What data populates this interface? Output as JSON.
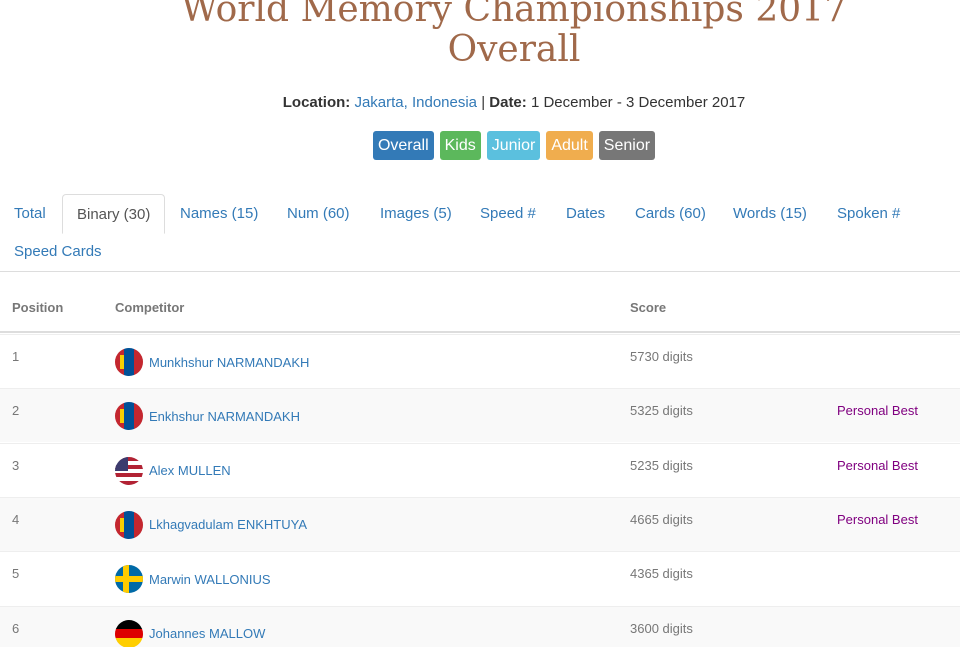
{
  "title": {
    "line1": "World Memory Championships 2017",
    "line2": "Overall"
  },
  "meta": {
    "location_label": "Location:",
    "location_value": "Jakarta, Indonesia",
    "separator": "|",
    "date_label": "Date:",
    "date_value": "1 December - 3 December 2017"
  },
  "categories": [
    {
      "label": "Overall",
      "color": "#337ab7"
    },
    {
      "label": "Kids",
      "color": "#5cb85c"
    },
    {
      "label": "Junior",
      "color": "#5bc0de"
    },
    {
      "label": "Adult",
      "color": "#f0ad4e"
    },
    {
      "label": "Senior",
      "color": "#777777"
    }
  ],
  "tabs": [
    {
      "label": "Total"
    },
    {
      "label": "Binary (30)",
      "active": true
    },
    {
      "label": "Names (15)"
    },
    {
      "label": "Num (60)"
    },
    {
      "label": "Images (5)"
    },
    {
      "label": "Speed #"
    },
    {
      "label": "Dates"
    },
    {
      "label": "Cards (60)"
    },
    {
      "label": "Words (15)"
    },
    {
      "label": "Spoken #"
    },
    {
      "label": "Speed Cards"
    }
  ],
  "table": {
    "headers": {
      "position": "Position",
      "competitor": "Competitor",
      "score": "Score"
    },
    "rows": [
      {
        "position": "1",
        "flag": "mongolia-flag-icon",
        "name": "Munkhshur NARMANDAKH",
        "score": "5730 digits",
        "note": ""
      },
      {
        "position": "2",
        "flag": "mongolia-flag-icon",
        "name": "Enkhshur NARMANDAKH",
        "score": "5325 digits",
        "note": "Personal Best"
      },
      {
        "position": "3",
        "flag": "usa-flag-icon",
        "name": "Alex MULLEN",
        "score": "5235 digits",
        "note": "Personal Best"
      },
      {
        "position": "4",
        "flag": "mongolia-flag-icon",
        "name": "Lkhagvadulam ENKHTUYA",
        "score": "4665 digits",
        "note": "Personal Best"
      },
      {
        "position": "5",
        "flag": "sweden-flag-icon",
        "name": "Marwin WALLONIUS",
        "score": "4365 digits",
        "note": ""
      },
      {
        "position": "6",
        "flag": "germany-flag-icon",
        "name": "Johannes MALLOW",
        "score": "3600 digits",
        "note": ""
      }
    ]
  },
  "colors": {
    "title": "#a0694a",
    "link": "#337ab7",
    "personal_best": "#800080"
  }
}
